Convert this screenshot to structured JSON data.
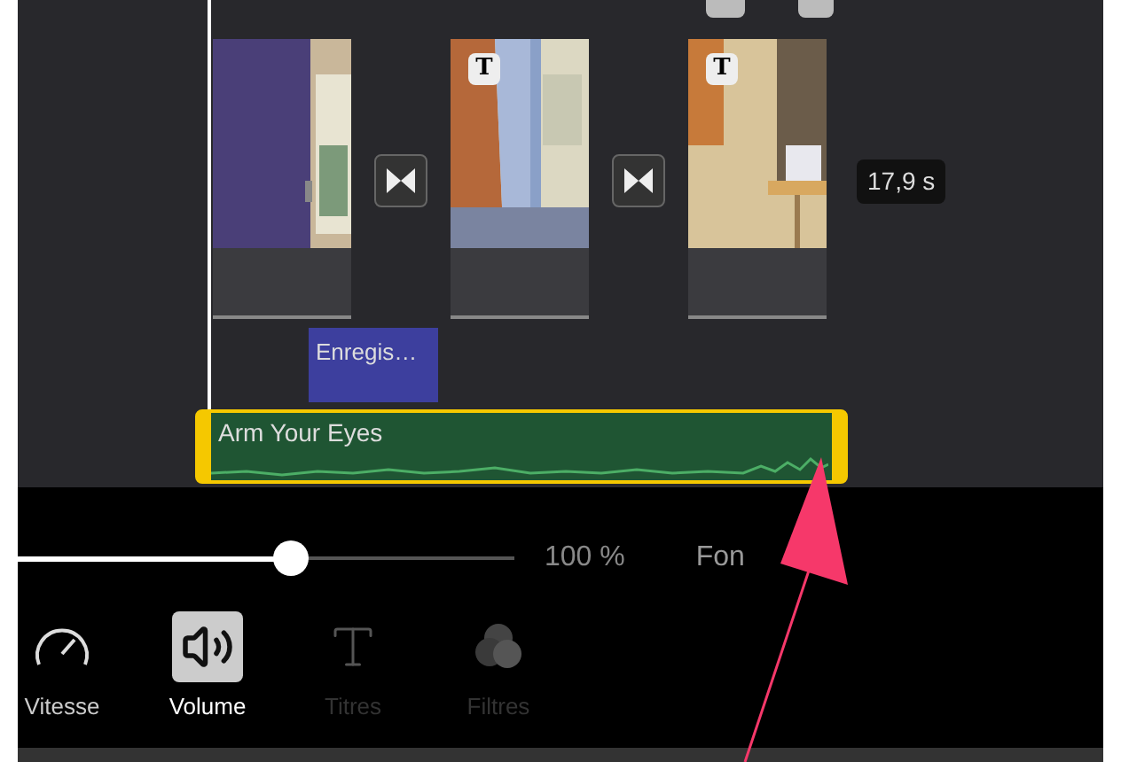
{
  "timeline": {
    "items": [
      {
        "kind": "clip"
      },
      {
        "kind": "transition"
      },
      {
        "kind": "clip",
        "badge": "T"
      },
      {
        "kind": "transition"
      },
      {
        "kind": "clip",
        "badge": "T"
      }
    ],
    "duration": "17,9 s",
    "recording": {
      "label": "Enregis…"
    },
    "music": {
      "label": "Arm Your Eyes",
      "selected": true
    }
  },
  "volume": {
    "level": 0.55,
    "reading": "100 %",
    "fade_label": "Fon"
  },
  "toolbar": [
    {
      "kind": "speed",
      "label": "Vitesse",
      "selected": false,
      "disabled": false
    },
    {
      "kind": "volume",
      "label": "Volume",
      "selected": true,
      "disabled": false
    },
    {
      "kind": "titles",
      "label": "Titres",
      "selected": false,
      "disabled": true
    },
    {
      "kind": "filters",
      "label": "Filtres",
      "selected": false,
      "disabled": true
    }
  ]
}
